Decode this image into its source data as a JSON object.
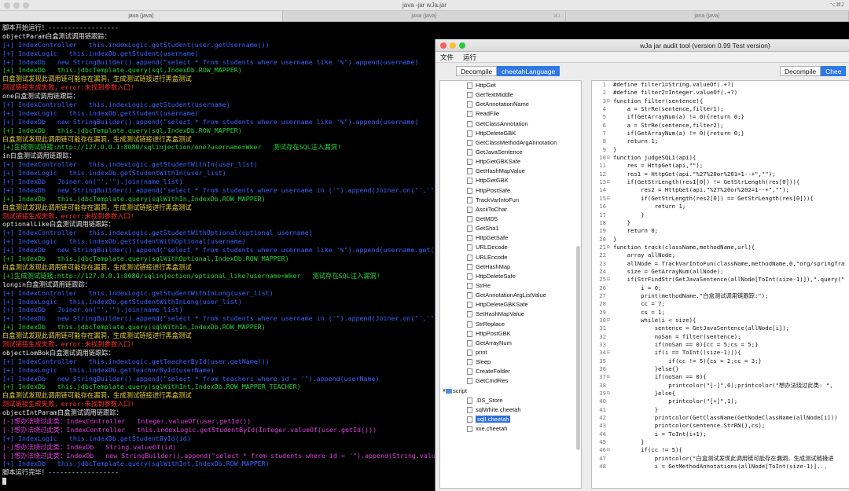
{
  "terminal": {
    "title": "java -jar wJa.jar",
    "shortcut": "⌥⌘2",
    "tabs": [
      {
        "label": "java (java)",
        "badge": "",
        "active": true
      },
      {
        "label": "java (java)",
        "badge": "⌘1",
        "active": false
      },
      {
        "label": "java (java)",
        "badge": "",
        "active": false
      }
    ],
    "lines": [
      {
        "t": "脚本开始运行！------------------",
        "c": "white"
      },
      {
        "t": "objectParam白盒测试调用链跟踪：",
        "c": "white"
      },
      {
        "t": "[+] IndexController   this.indexLogic.getStudent(user.getUsername())",
        "c": "blue"
      },
      {
        "t": "[+] IndexLogic   this.indexDb.getStudent(username)",
        "c": "blue"
      },
      {
        "t": "[+] IndexDb   new StringBuilder().append(\"select * from students where username like '%\").append(username)",
        "c": "blue"
      },
      {
        "t": "[+] IndexDb   this.jdbcTemplate.query(sql,IndexDb.ROW_MAPPER)",
        "c": "green"
      },
      {
        "t": "白盒测试发现此调用链可能存在漏洞，生成测试链接进行黑盒测试",
        "c": "yellow"
      },
      {
        "t": "测试链接生成失败，error:未找到参数入口!",
        "c": "red"
      },
      {
        "t": "one白盒测试调用链跟踪：",
        "c": "white"
      },
      {
        "t": "[+] IndexController   this.indexLogic.getStudent(username)",
        "c": "blue"
      },
      {
        "t": "[+] IndexLogic   this.indexDb.getStudent(username)",
        "c": "blue"
      },
      {
        "t": "[+] IndexDb   new StringBuilder().append(\"select * from students where username like '%\").append(username)",
        "c": "blue"
      },
      {
        "t": "[+] IndexDb   this.jdbcTemplate.query(sql,IndexDb.ROW_MAPPER)",
        "c": "green"
      },
      {
        "t": "白盒测试发现此调用链可能存在漏洞，生成测试链接进行黑盒测试",
        "c": "yellow"
      },
      {
        "t": "[+]生成测试链接:http://127.0.0.1:8080/sqlinjection/one?username=Wker   测试存在SQL注入漏洞!",
        "c": "green"
      },
      {
        "t": "in白盒测试调用链跟踪：",
        "c": "white"
      },
      {
        "t": "[+] IndexController   this.indexLogic.getStudentWithIn(user_list)",
        "c": "blue"
      },
      {
        "t": "[+] IndexLogic   this.indexDb.getStudentWithIn(user_list)",
        "c": "blue"
      },
      {
        "t": "[+] IndexDb   Joiner.on(\"','\").join(name_list)",
        "c": "blue"
      },
      {
        "t": "[+] IndexDb   new StringBuilder().append(\"select * from students where username in ('\").append(Joiner.on(\"','\").join(name_list)",
        "c": "blue"
      },
      {
        "t": "[+] IndexDb   this.jdbcTemplate.query(sqlWithIn,IndexDb.ROW_MAPPER)",
        "c": "green"
      },
      {
        "t": "白盒测试发现此调用链可能存在漏洞，生成测试链接进行黑盒测试",
        "c": "yellow"
      },
      {
        "t": "测试链接生成失败，error:未找到参数入口!",
        "c": "red"
      },
      {
        "t": "optionalLike白盒测试调用链跟踪：",
        "c": "white"
      },
      {
        "t": "[+] IndexController   this.indexLogic.getStudentWithOptional(optional_username)",
        "c": "blue"
      },
      {
        "t": "[+] IndexLogic   this.indexDb.getStudentWithOptional(username)",
        "c": "blue"
      },
      {
        "t": "[+] IndexDb   new StringBuilder().append(\"select * from students where username like '%\").append(username.get())",
        "c": "blue"
      },
      {
        "t": "[+] IndexDb   this.jdbcTemplate.query(sqlWithOptional,IndexDb.ROW_MAPPER)",
        "c": "green"
      },
      {
        "t": "白盒测试发现此调用链可能存在漏洞，生成测试链接进行黑盒测试",
        "c": "yellow"
      },
      {
        "t": "[+]生成测试链接:http://127.0.0.1:8080/sqlinjection/optional_like?username=Wker   测试存在SQL注入漏洞!",
        "c": "green"
      },
      {
        "t": "longin白盒测试调用链跟踪：",
        "c": "white"
      },
      {
        "t": "[+] IndexController   this.indexLogic.getStudentWithInLong(user_list)",
        "c": "blue"
      },
      {
        "t": "[+] IndexLogic   this.indexDb.getStudentWithInLong(user_list)",
        "c": "blue"
      },
      {
        "t": "[+] IndexDb   Joiner.on(\"','\").join(name_list)",
        "c": "blue"
      },
      {
        "t": "[+] IndexDb   new StringBuilder().append(\"select * from students where username in ('\").append(Joiner.on(\"','\").join(name_l",
        "c": "blue"
      },
      {
        "t": "[+] IndexDb   this.jdbcTemplate.query(sqlWithIn,IndexDb.ROW_MAPPER)",
        "c": "green"
      },
      {
        "t": "白盒测试发现此调用链可能存在漏洞，生成测试链接进行黑盒测试",
        "c": "yellow"
      },
      {
        "t": "测试链接生成失败，error:未找到参数入口!",
        "c": "red"
      },
      {
        "t": "objectLomBok白盒测试调用链跟踪：",
        "c": "white"
      },
      {
        "t": "[+] IndexController   this.indexLogic.getTeacherById(user.getName())",
        "c": "blue"
      },
      {
        "t": "[+] IndexLogic   this.indexDb.getTeacherById(userName)",
        "c": "blue"
      },
      {
        "t": "[+] IndexDb   new StringBuilder().append(\"select * from teachers where id = '\").append(userName)",
        "c": "blue"
      },
      {
        "t": "[+] IndexDb   this.jdbcTemplate.query(sqlWithInt,IndexDb.ROW_MAPPER_TEACHER)",
        "c": "green"
      },
      {
        "t": "白盒测试发现此调用链可能存在漏洞，生成测试链接进行黑盒测试",
        "c": "yellow"
      },
      {
        "t": "测试链接生成失败，error:未找到参数入口!",
        "c": "red"
      },
      {
        "t": "objectIntParam白盒测试调用链跟踪：",
        "c": "white"
      },
      {
        "t": "[-]想办法绕过此类：IndexController   Integer.valueOf(user.getId())",
        "c": "magenta"
      },
      {
        "t": "[-]想办法绕过此类：IndexController   this.indexLogic.getStudentById(Integer.valueOf(user.getId()))",
        "c": "magenta"
      },
      {
        "t": "[+] IndexLogic   this.indexDb.getStudentById(id)",
        "c": "blue"
      },
      {
        "t": "[-]想办法绕过此类：IndexDb   String.valueOf(id)",
        "c": "magenta"
      },
      {
        "t": "[-]想办法绕过此类：IndexDb   new StringBuilder().append(\"select * from students where id = '\").append(String.valueOf(id))",
        "c": "magenta"
      },
      {
        "t": "[+] IndexDb   this.jdbcTemplate.query(sqlWithInt,IndexDb.ROW_MAPPER)",
        "c": "blue"
      },
      {
        "t": "脚本运行完毕！------------------",
        "c": "white"
      }
    ]
  },
  "app": {
    "title": "wJa jar audit tool (version 0.99 Test version)",
    "menus": [
      "文件",
      "运行"
    ],
    "left_tabs": [
      {
        "label": "Decompile",
        "selected": false
      },
      {
        "label": "cheetahLanguage",
        "selected": true
      }
    ],
    "right_tabs": [
      {
        "label": "Decompile",
        "selected": false
      },
      {
        "label": "Chee",
        "selected": true
      }
    ],
    "tree": [
      {
        "label": "HttpGet",
        "kind": "file"
      },
      {
        "label": "GetTextMiddle",
        "kind": "file"
      },
      {
        "label": "GetAnnotationName",
        "kind": "file"
      },
      {
        "label": "ReadFile",
        "kind": "file"
      },
      {
        "label": "GetClassAnnotation",
        "kind": "file"
      },
      {
        "label": "HttpDeleteGBK",
        "kind": "file"
      },
      {
        "label": "GetClassMethodArgAnnotation",
        "kind": "file"
      },
      {
        "label": "GetJavaSentence",
        "kind": "file"
      },
      {
        "label": "HttpGetGBKSafe",
        "kind": "file"
      },
      {
        "label": "GetHashMapValue",
        "kind": "file"
      },
      {
        "label": "HttpGetGBK",
        "kind": "file"
      },
      {
        "label": "HttpPostSafe",
        "kind": "file"
      },
      {
        "label": "TrackVarIntoFun",
        "kind": "file"
      },
      {
        "label": "AsciiToChar",
        "kind": "file"
      },
      {
        "label": "GetMD5",
        "kind": "file"
      },
      {
        "label": "GetSha1",
        "kind": "file"
      },
      {
        "label": "HttpGetSafe",
        "kind": "file"
      },
      {
        "label": "URLDecode",
        "kind": "file"
      },
      {
        "label": "URLEncode",
        "kind": "file"
      },
      {
        "label": "GetHashMap",
        "kind": "file"
      },
      {
        "label": "HttpDeleteSafe",
        "kind": "file"
      },
      {
        "label": "StrRe",
        "kind": "file"
      },
      {
        "label": "GetAnnotationArgListValue",
        "kind": "file"
      },
      {
        "label": "HttpDeleteGBKSafe",
        "kind": "file"
      },
      {
        "label": "SetHashMapValue",
        "kind": "file"
      },
      {
        "label": "StrReplace",
        "kind": "file"
      },
      {
        "label": "HttpPostGBK",
        "kind": "file"
      },
      {
        "label": "GetArrayNum",
        "kind": "file"
      },
      {
        "label": "print",
        "kind": "file"
      },
      {
        "label": "Sleep",
        "kind": "file"
      },
      {
        "label": "CreateFolder",
        "kind": "file"
      },
      {
        "label": "GetCmdRes",
        "kind": "file"
      },
      {
        "label": "script",
        "kind": "folder"
      },
      {
        "label": ".DS_Store",
        "kind": "file"
      },
      {
        "label": "sqlWhite.cheetah",
        "kind": "file"
      },
      {
        "label": "sqlI.cheetah",
        "kind": "file",
        "selected": true
      },
      {
        "label": "xxe.cheetah",
        "kind": "file"
      }
    ],
    "code": [
      {
        "n": "1",
        "f": "",
        "t": "#define filter1=String.valueOf(.+?)"
      },
      {
        "n": "2",
        "f": "",
        "t": "#define filter2=Integer.valueOf(.+?)"
      },
      {
        "n": "3",
        "f": "⊟",
        "t": "function filter(sentence){"
      },
      {
        "n": "4",
        "f": "",
        "t": "    a = StrRe(sentence,filter1);"
      },
      {
        "n": "5",
        "f": "",
        "t": "    if(GetArrayNum(a) != 0){return 0;}"
      },
      {
        "n": "6",
        "f": "",
        "t": "    a = StrRe(sentence,filter2);"
      },
      {
        "n": "7",
        "f": "",
        "t": "    if(GetArrayNum(a) != 0){return 0;}"
      },
      {
        "n": "8",
        "f": "",
        "t": "    return 1;"
      },
      {
        "n": "9",
        "f": "",
        "t": "}"
      },
      {
        "n": "10",
        "f": "⊟",
        "t": "function judgeSQLI(api){"
      },
      {
        "n": "11",
        "f": "",
        "t": "    res = HttpGet(api,\"\");"
      },
      {
        "n": "12",
        "f": "",
        "t": "    res1 = HttpGet(api.\"%27%20or%201=1--+\",\"\");"
      },
      {
        "n": "13",
        "f": "⊟",
        "t": "    if(GetStrLength(res1[0]) != GetStrLength(res[0])){"
      },
      {
        "n": "14",
        "f": "",
        "t": "        res2 = HttpGet(api.\"%27%20or%202=1--+\",\"\");"
      },
      {
        "n": "15",
        "f": "⊟",
        "t": "        if(GetStrLength(res2[0]) == GetStrLength(res[0])){"
      },
      {
        "n": "16",
        "f": "",
        "t": "            return 1;"
      },
      {
        "n": "17",
        "f": "",
        "t": "        }"
      },
      {
        "n": "18",
        "f": "",
        "t": "    }"
      },
      {
        "n": "19",
        "f": "",
        "t": "    return 0;"
      },
      {
        "n": "20",
        "f": "",
        "t": "}"
      },
      {
        "n": "21",
        "f": "⊟",
        "t": "function track(className,methodName,url){"
      },
      {
        "n": "22",
        "f": "",
        "t": "    array allNode;"
      },
      {
        "n": "23",
        "f": "",
        "t": "    allNode = TrackVarIntoFun(className,methodName,0,\"org/springfra"
      },
      {
        "n": "24",
        "f": "",
        "t": "    size = GetArrayNum(allNode);"
      },
      {
        "n": "25",
        "f": "⊟",
        "t": "    if(StrFindStr(GetJavaSentence(allNode[ToInt(size-1)]),\".query(\""
      },
      {
        "n": "26",
        "f": "",
        "t": "        i = 0;"
      },
      {
        "n": "27",
        "f": "",
        "t": "        print(methodName.\"白盒测试调用链跟踪:\");"
      },
      {
        "n": "28",
        "f": "",
        "t": "        cc = 7;"
      },
      {
        "n": "29",
        "f": "",
        "t": "        cs = 1;"
      },
      {
        "n": "30",
        "f": "⊟",
        "t": "        while(i < size){"
      },
      {
        "n": "31",
        "f": "",
        "t": "            sentence = GetJavaSentence(allNode[i]);"
      },
      {
        "n": "32",
        "f": "",
        "t": "            noSan = filter(sentence);"
      },
      {
        "n": "33",
        "f": "",
        "t": "            if(noSan == 0){cc = 5;cs = 5;}"
      },
      {
        "n": "34",
        "f": "⊟",
        "t": "            if(i == ToInt((size-1))){"
      },
      {
        "n": "35",
        "f": "",
        "t": "                if(cc != 5){cs = 2;cc = 3;}"
      },
      {
        "n": "36",
        "f": "",
        "t": "            }else{}"
      },
      {
        "n": "37",
        "f": "⊟",
        "t": "            if(noSan == 0){"
      },
      {
        "n": "38",
        "f": "",
        "t": "                printcolor(\"[-]\",6);printcolor(\"想办法绕过此类: \","
      },
      {
        "n": "39",
        "f": "⊟",
        "t": "            }else{"
      },
      {
        "n": "40",
        "f": "",
        "t": "                printcolor(\"[+]\",1);"
      },
      {
        "n": "41",
        "f": "",
        "t": "            }"
      },
      {
        "n": "42",
        "f": "",
        "t": "            printcolor(GetClassName(GetNodeClassName(allNode[i]))"
      },
      {
        "n": "43",
        "f": "",
        "t": "            printcolor(sentence.StrRN(),cs);"
      },
      {
        "n": "44",
        "f": "",
        "t": "            i = ToInt(i+1);"
      },
      {
        "n": "45",
        "f": "",
        "t": "        }"
      },
      {
        "n": "46",
        "f": "⊟",
        "t": "        if(cc != 5){"
      },
      {
        "n": "47",
        "f": "",
        "t": "            printcolor(\"白盒测试发现此调用链可能存在漏洞，生成测试链接进"
      },
      {
        "n": "48",
        "f": "",
        "t": "            i = GetMethodAnnotations(allNode[ToInt(size-1)]..."
      }
    ]
  }
}
